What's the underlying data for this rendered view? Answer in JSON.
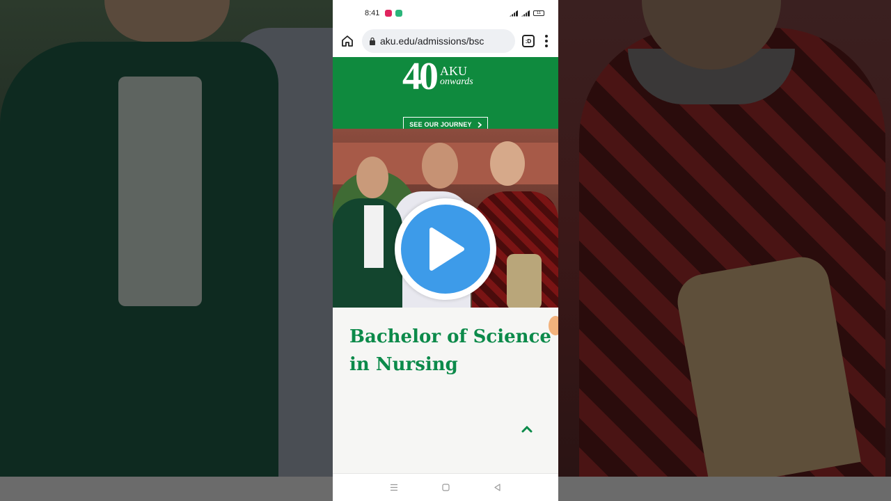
{
  "status": {
    "time": "8:41",
    "battery": "11"
  },
  "browser": {
    "url": "aku.edu/admissions/bsc",
    "tabs_count": ":D"
  },
  "banner": {
    "logo_number": "40",
    "logo_text": "AKU",
    "logo_tagline": "onwards",
    "journey_button": "SEE OUR JOURNEY"
  },
  "page": {
    "title": "Bachelor of Science in Nursing"
  },
  "colors": {
    "banner_green": "#0f8a3e",
    "title_green": "#0c8a4a",
    "play_blue": "#3d9be9"
  },
  "icons": {
    "home": "home-icon",
    "lock": "lock-icon",
    "menu": "more-vert-icon",
    "play": "play-icon",
    "scroll_top": "chevron-up-icon",
    "nav_recents": "menu-lines-icon",
    "nav_home": "square-icon",
    "nav_back": "triangle-back-icon"
  }
}
